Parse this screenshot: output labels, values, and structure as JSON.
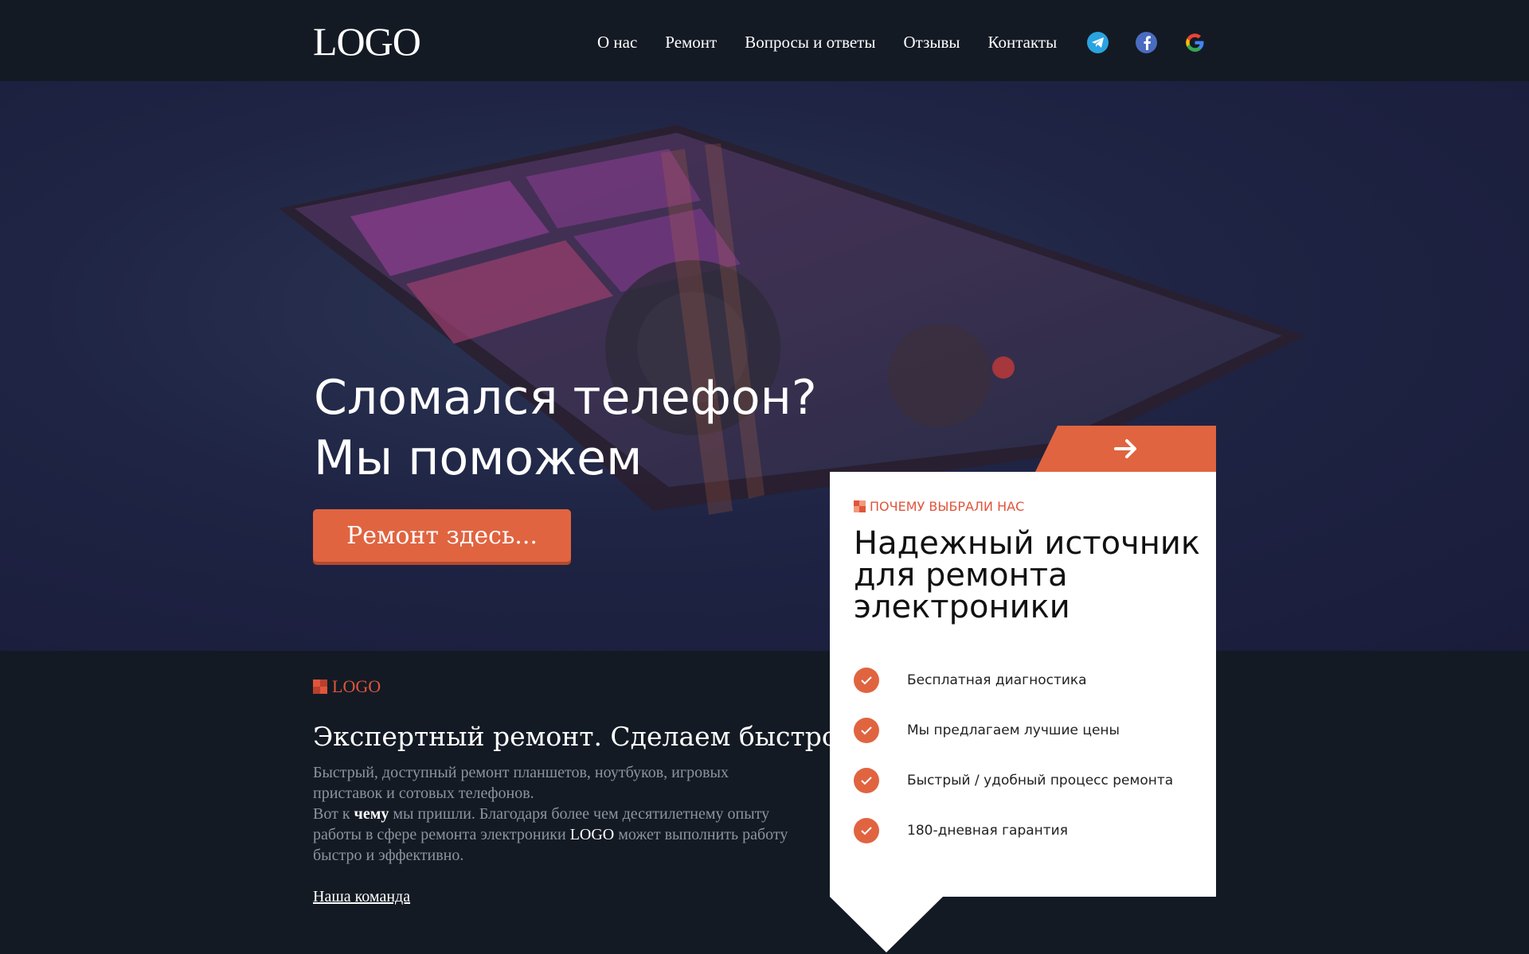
{
  "header": {
    "logo": "LOGO",
    "nav": [
      "О нас",
      "Ремонт",
      "Вопросы и ответы",
      "Отзывы",
      "Контакты"
    ],
    "socials": [
      "telegram-icon",
      "facebook-icon",
      "google-icon"
    ]
  },
  "hero": {
    "title_line1": "Сломался телефон?",
    "title_line2": "Мы поможем",
    "button": "Ремонт здесь..."
  },
  "about": {
    "tag": "LOGO",
    "title": "Экспертный ремонт. Сделаем быстро",
    "p1": "Быстрый, доступный ремонт планшетов, ноутбуков, игровых приставок и сотовых телефонов.",
    "p2_a": "Вот к ",
    "p2_bold": "чему",
    "p2_b": " мы пришли. Благодаря более чем десятилетнему опыту работы в сфере ремонта электроники ",
    "p2_logo": "LOGO",
    "p2_c": " может выполнить работу быстро и эффективно.",
    "link": "Наша команда"
  },
  "card": {
    "tag": "ПОЧЕМУ ВЫБРАЛИ НАС",
    "title": "Надежный источник для ремонта электроники",
    "features": [
      "Бесплатная диагностика",
      "Мы предлагаем лучшие цены",
      "Быстрый / удобный процесс ремонта",
      "180-дневная гарантия"
    ]
  },
  "colors": {
    "accent": "#e06440",
    "background": "#141a24",
    "hero": "#1f2444"
  }
}
